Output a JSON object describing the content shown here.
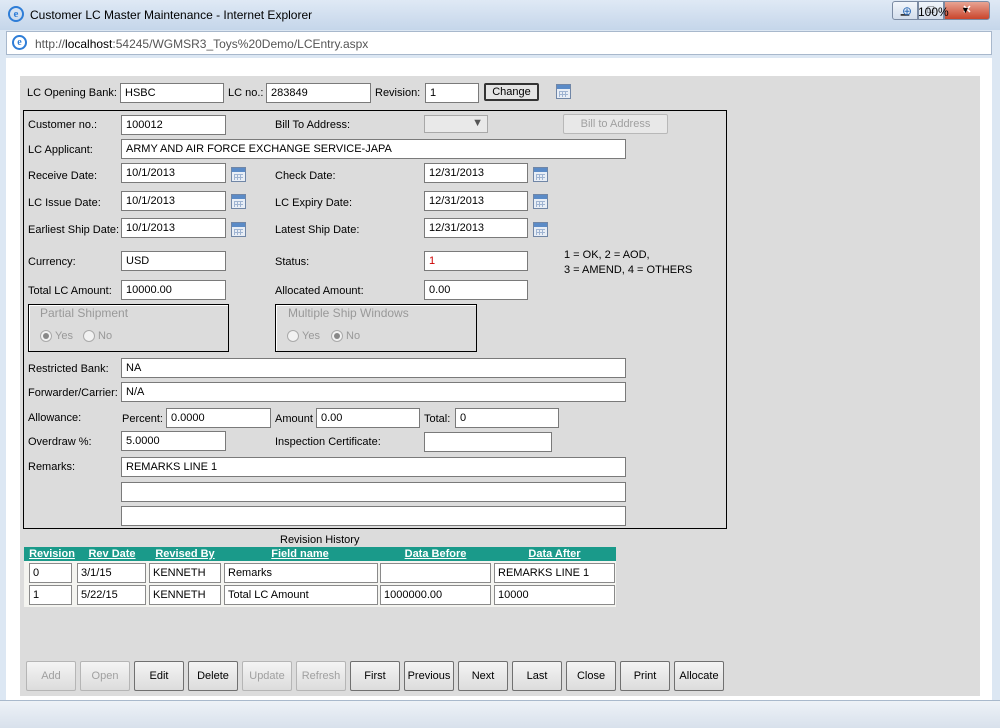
{
  "window": {
    "title": "Customer LC Master Maintenance - Internet Explorer",
    "min_label": "▁",
    "max_label": "□",
    "close_label": "✕"
  },
  "address": {
    "host_bold": "localhost",
    "prefix": "http://",
    "rest": ":54245/WGMSR3_Toys%20Demo/LCEntry.aspx"
  },
  "header": {
    "bank_label": "LC Opening Bank:",
    "bank_value": "HSBC",
    "lcno_label": "LC no.:",
    "lcno_value": "283849",
    "revision_label": "Revision:",
    "revision_value": "1",
    "change_label": "Change"
  },
  "form": {
    "customer_label": "Customer no.:",
    "customer_value": "100012",
    "billto_label": "Bill To Address:",
    "billto_button": "Bill to Address",
    "applicant_label": "LC Applicant:",
    "applicant_value": "ARMY AND AIR FORCE EXCHANGE SERVICE-JAPA",
    "receive_label": "Receive Date:",
    "receive_value": "10/1/2013",
    "check_label": "Check Date:",
    "check_value": "12/31/2013",
    "issue_label": "LC Issue Date:",
    "issue_value": "10/1/2013",
    "expiry_label": "LC Expiry Date:",
    "expiry_value": "12/31/2013",
    "earliest_label": "Earliest Ship Date:",
    "earliest_value": "10/1/2013",
    "latest_label": "Latest Ship Date:",
    "latest_value": "12/31/2013",
    "currency_label": "Currency:",
    "currency_value": "USD",
    "status_label": "Status:",
    "status_value": "1",
    "status_note_1": "1 = OK, 2 = AOD,",
    "status_note_2": "3 = AMEND, 4 = OTHERS",
    "total_label": "Total LC Amount:",
    "total_value": "10000.00",
    "allocated_label": "Allocated Amount:",
    "allocated_value": "0.00",
    "partial_legend": "Partial Shipment",
    "partial_yes": "Yes",
    "partial_no": "No",
    "multi_legend": "Multiple Ship Windows",
    "multi_yes": "Yes",
    "multi_no": "No",
    "restricted_label": "Restricted Bank:",
    "restricted_value": "NA",
    "forwarder_label": "Forwarder/Carrier:",
    "forwarder_value": "N/A",
    "allowance_label": "Allowance:",
    "percent_label": "Percent:",
    "percent_value": "0.0000",
    "amount_label": "Amount",
    "amount_value": "0.00",
    "allow_total_label": "Total:",
    "allow_total_value": "0",
    "overdraw_label": "Overdraw %:",
    "overdraw_value": "5.0000",
    "inspection_label": "Inspection Certificate:",
    "inspection_value": "",
    "remarks_label": "Remarks:",
    "remarks_1": "REMARKS LINE 1",
    "remarks_2": "",
    "remarks_3": ""
  },
  "history": {
    "title": "Revision History",
    "columns": [
      "Revision",
      "Rev Date",
      "Revised By",
      "Field name",
      "Data Before",
      "Data After"
    ],
    "rows": [
      [
        "0",
        "3/1/15",
        "KENNETH",
        "Remarks",
        "",
        "REMARKS LINE 1"
      ],
      [
        "1",
        "5/22/15",
        "KENNETH",
        "Total LC Amount",
        "1000000.00",
        "10000"
      ]
    ]
  },
  "buttons": [
    "Add",
    "Open",
    "Edit",
    "Delete",
    "Update",
    "Refresh",
    "First",
    "Previous",
    "Next",
    "Last",
    "Close",
    "Print",
    "Allocate"
  ],
  "statusbar": {
    "zoom": "100%"
  }
}
